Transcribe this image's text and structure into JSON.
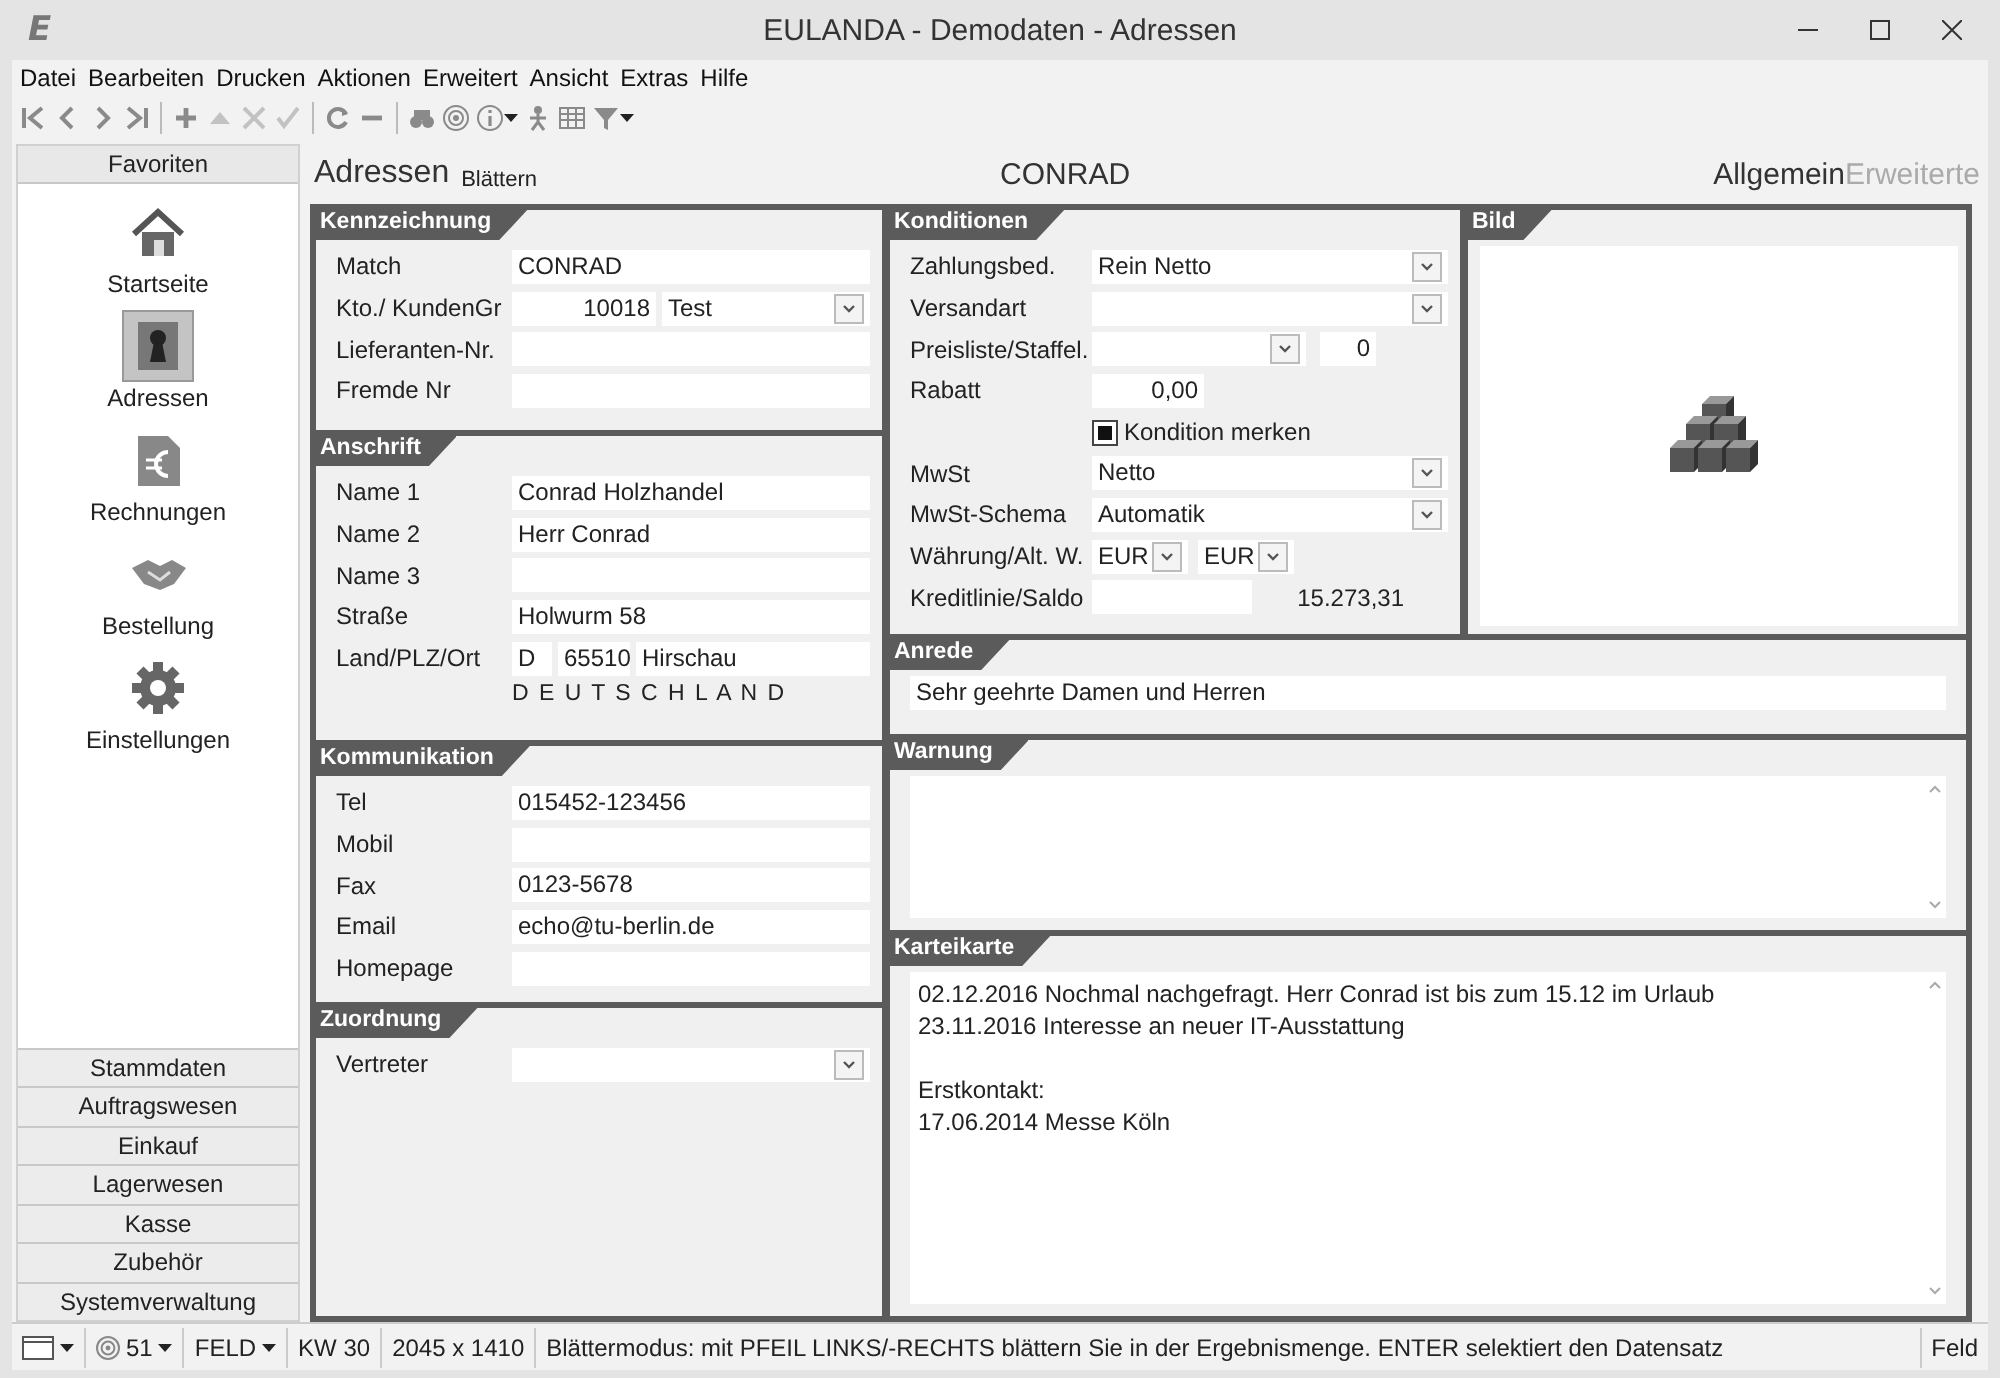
{
  "window": {
    "logo": "E",
    "title": "EULANDA - Demodaten - Adressen"
  },
  "menu": [
    "Datei",
    "Bearbeiten",
    "Drucken",
    "Aktionen",
    "Erweitert",
    "Ansicht",
    "Extras",
    "Hilfe"
  ],
  "sidebar": {
    "header": "Favoriten",
    "favorites": [
      {
        "label": "Startseite",
        "selected": false
      },
      {
        "label": "Adressen",
        "selected": true
      },
      {
        "label": "Rechnungen",
        "selected": false
      },
      {
        "label": "Bestellung",
        "selected": false
      },
      {
        "label": "Einstellungen",
        "selected": false
      }
    ],
    "sections": [
      "Stammdaten",
      "Auftragswesen",
      "Einkauf",
      "Lagerwesen",
      "Kasse",
      "Zubehör",
      "Systemverwaltung"
    ]
  },
  "header": {
    "title": "Adressen",
    "mode": "Blättern",
    "record": "CONRAD",
    "tabs": [
      {
        "label": "Allgemein",
        "selected": true
      },
      {
        "label": "Erweiterte",
        "selected": false
      }
    ]
  },
  "identification": {
    "title": "Kennzeichnung",
    "rows": [
      {
        "kind": "text",
        "label": "Match",
        "value": "CONRAD"
      },
      {
        "kind": "account",
        "label": "Kto./ KundenGr",
        "number": "10018",
        "value": "Test"
      },
      {
        "kind": "text",
        "label": "Lieferanten-Nr."
      },
      {
        "kind": "text",
        "label": "Fremde Nr"
      }
    ]
  },
  "address": {
    "title": "Anschrift",
    "rows": [
      {
        "kind": "text",
        "label": "Name 1",
        "value": "Conrad Holzhandel"
      },
      {
        "kind": "text",
        "label": "Name 2",
        "value": "Herr Conrad"
      },
      {
        "kind": "text",
        "label": "Name 3"
      },
      {
        "kind": "text",
        "label": "Straße",
        "value": "Holwurm 58"
      },
      {
        "kind": "address",
        "label": "Land/PLZ/Ort",
        "country": "D",
        "zip": "65510",
        "city": "Hirschau"
      },
      {
        "kind": "note",
        "value": "D E U T S C H L A N D"
      }
    ]
  },
  "communication": {
    "title": "Kommunikation",
    "rows": [
      {
        "kind": "text",
        "label": "Tel",
        "value": "015452-123456"
      },
      {
        "kind": "text",
        "label": "Mobil"
      },
      {
        "kind": "text",
        "label": "Fax",
        "value": "0123-5678"
      },
      {
        "kind": "text",
        "label": "Email",
        "value": "echo@tu-berlin.de"
      },
      {
        "kind": "text",
        "label": "Homepage"
      }
    ]
  },
  "assignment": {
    "title": "Zuordnung",
    "rows": [
      {
        "kind": "combo",
        "label": "Vertreter"
      }
    ]
  },
  "conditions": {
    "title": "Konditionen",
    "rows": [
      {
        "kind": "combo",
        "label": "Zahlungsbed.",
        "value": "Rein Netto"
      },
      {
        "kind": "combo",
        "label": "Versandart"
      },
      {
        "kind": "combo_num",
        "label": "Preisliste/Staffel.",
        "number": "0"
      },
      {
        "kind": "short",
        "label": "Rabatt",
        "value": "0,00"
      },
      {
        "kind": "checkbox",
        "text": "Kondition merken",
        "checked": true
      },
      {
        "kind": "combo",
        "label": "MwSt",
        "value": "Netto"
      },
      {
        "kind": "combo",
        "label": "MwSt-Schema",
        "value": "Automatik"
      },
      {
        "kind": "combo_pair",
        "label": "Währung/Alt. W.",
        "values": [
          "EUR",
          "EUR"
        ]
      },
      {
        "kind": "credit",
        "label": "Kreditlinie/Saldo",
        "reading": "15.273,31"
      }
    ]
  },
  "picture": {
    "title": "Bild"
  },
  "salutation": {
    "title": "Anrede",
    "value": "Sehr geehrte Damen und Herren"
  },
  "warning": {
    "title": "Warnung"
  },
  "card": {
    "title": "Karteikarte",
    "text": "02.12.2016 Nochmal nachgefragt. Herr Conrad ist bis zum 15.12 im Urlaub\n23.11.2016 Interesse an neuer IT-Ausstattung\n\nErstkontakt:\n17.06.2014 Messe Köln"
  },
  "status_bar": [
    {
      "kind": "view"
    },
    {
      "kind": "count",
      "text": "51"
    },
    {
      "kind": "dropdown",
      "text": "FELD"
    },
    {
      "kind": "text",
      "text": "KW 30"
    },
    {
      "kind": "text",
      "text": "2045 x 1410"
    },
    {
      "kind": "message",
      "text": "Blättermodus: mit PFEIL LINKS/-RECHTS blättern Sie in der Ergebnismenge. ENTER selektiert den Datensatz"
    },
    {
      "kind": "text",
      "text": "Feld"
    }
  ]
}
